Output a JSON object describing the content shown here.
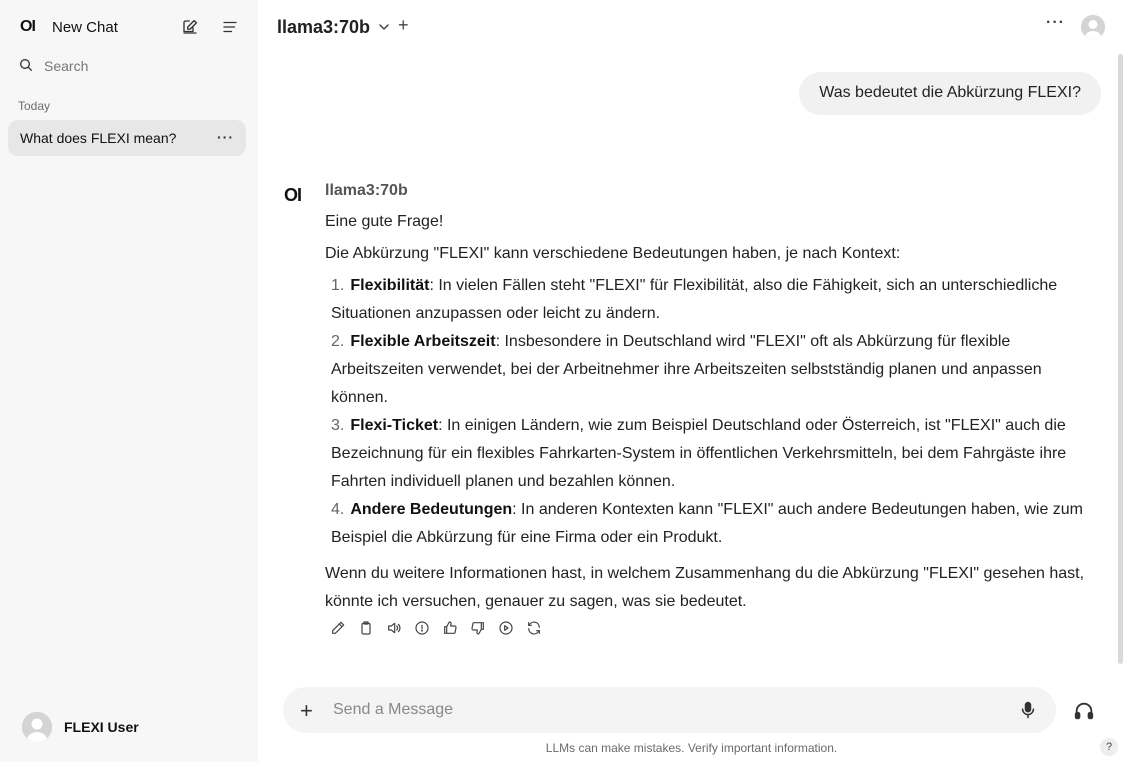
{
  "sidebar": {
    "logo": "OI",
    "new_chat_label": "New Chat",
    "search_placeholder": "Search",
    "section_label": "Today",
    "chat_item_label": "What does FLEXI mean?",
    "chat_item_more": "···",
    "user_name": "FLEXI User"
  },
  "header": {
    "model_name": "llama3:70b",
    "add": "+",
    "more": "···"
  },
  "conversation": {
    "user_message": "Was bedeutet die Abkürzung FLEXI?",
    "assistant_logo": "OI",
    "assistant_name": "llama3:70b",
    "intro": "Eine gute Frage!",
    "lead": "Die Abkürzung \"FLEXI\" kann verschiedene Bedeutungen haben, je nach Kontext:",
    "items": [
      {
        "num": "1.",
        "title": "Flexibilität",
        "text": ": In vielen Fällen steht \"FLEXI\" für Flexibilität, also die Fähigkeit, sich an unterschiedliche Situationen anzupassen oder leicht zu ändern."
      },
      {
        "num": "2.",
        "title": "Flexible Arbeitszeit",
        "text": ": Insbesondere in Deutschland wird \"FLEXI\" oft als Abkürzung für flexible Arbeitszeiten verwendet, bei der Arbeitnehmer ihre Arbeitszeiten selbstständig planen und anpassen können."
      },
      {
        "num": "3.",
        "title": "Flexi-Ticket",
        "text": ": In einigen Ländern, wie zum Beispiel Deutschland oder Österreich, ist \"FLEXI\" auch die Bezeichnung für ein flexibles Fahrkarten-System in öffentlichen Verkehrsmitteln, bei dem Fahrgäste ihre Fahrten individuell planen und bezahlen können."
      },
      {
        "num": "4.",
        "title": "Andere Bedeutungen",
        "text": ": In anderen Kontexten kann \"FLEXI\" auch andere Bedeutungen haben, wie zum Beispiel die Abkürzung für eine Firma oder ein Produkt."
      }
    ],
    "closing": "Wenn du weitere Informationen hast, in welchem Zusammenhang du die Abkürzung \"FLEXI\" gesehen hast, könnte ich versuchen, genauer zu sagen, was sie bedeutet.",
    "actions": [
      "edit-icon",
      "copy-icon",
      "speaker-icon",
      "info-icon",
      "thumbs-up-icon",
      "thumbs-down-icon",
      "play-icon",
      "regenerate-icon"
    ]
  },
  "composer": {
    "plus": "+",
    "placeholder": "Send a Message",
    "disclaimer": "LLMs can make mistakes. Verify important information.",
    "help": "?"
  }
}
